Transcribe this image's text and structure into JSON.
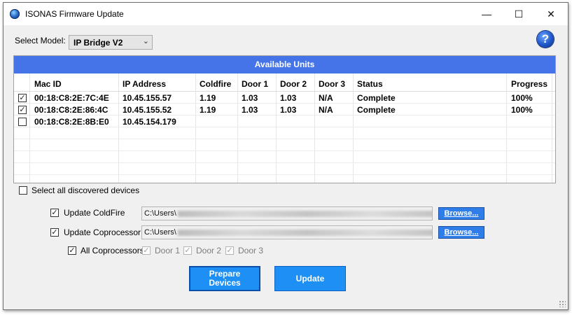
{
  "window": {
    "title": "ISONAS Firmware Update",
    "minimize_glyph": "—",
    "maximize_glyph": "☐",
    "close_glyph": "✕"
  },
  "help": {
    "icon": "help-icon",
    "glyph": "?"
  },
  "model": {
    "label": "Select Model:",
    "value": "IP Bridge V2",
    "arrow": "⌄"
  },
  "units": {
    "header": "Available Units",
    "columns": [
      "Mac ID",
      "IP Address",
      "Coldfire",
      "Door 1",
      "Door 2",
      "Door 3",
      "Status",
      "Progress"
    ],
    "rows": [
      {
        "checked": true,
        "mac": "00:18:C8:2E:7C:4E",
        "ip": "10.45.155.57",
        "coldfire": "1.19",
        "door1": "1.03",
        "door2": "1.03",
        "door3": "N/A",
        "status": "Complete",
        "progress": "100%"
      },
      {
        "checked": true,
        "mac": "00:18:C8:2E:86:4C",
        "ip": "10.45.155.52",
        "coldfire": "1.19",
        "door1": "1.03",
        "door2": "1.03",
        "door3": "N/A",
        "status": "Complete",
        "progress": "100%"
      },
      {
        "checked": false,
        "mac": "00:18:C8:2E:8B:E0",
        "ip": "10.45.154.179",
        "coldfire": "",
        "door1": "",
        "door2": "",
        "door3": "",
        "status": "",
        "progress": ""
      }
    ]
  },
  "select_all": {
    "label": "Select all discovered devices",
    "checked": false
  },
  "coldfire": {
    "label": "Update ColdFire",
    "checked": true,
    "path": "C:\\Users\\",
    "browse": "Browse..."
  },
  "coprocessor": {
    "label": "Update Coprocessor",
    "checked": true,
    "path": "C:\\Users\\",
    "browse": "Browse..."
  },
  "all_coprocessors": {
    "label": "All Coprocessors",
    "checked": true
  },
  "doors": [
    {
      "label": "Door 1",
      "checked": true
    },
    {
      "label": "Door 2",
      "checked": true
    },
    {
      "label": "Door 3",
      "checked": true
    }
  ],
  "actions": {
    "prepare": "Prepare Devices",
    "update": "Update"
  },
  "colors": {
    "accent": "#4573e8",
    "button": "#1e90f5",
    "browse": "#2e7de8"
  }
}
